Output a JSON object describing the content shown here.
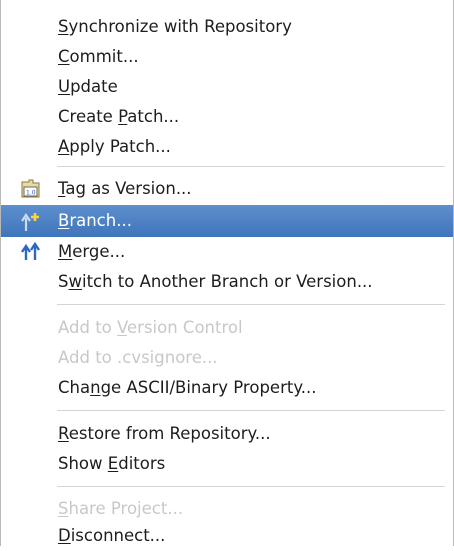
{
  "menu": {
    "items": [
      {
        "pre": "",
        "mn": "S",
        "post": "ynchronize with Repository",
        "enabled": true
      },
      {
        "pre": "",
        "mn": "C",
        "post": "ommit...",
        "enabled": true
      },
      {
        "pre": "",
        "mn": "U",
        "post": "pdate",
        "enabled": true
      },
      {
        "pre": "Create ",
        "mn": "P",
        "post": "atch...",
        "enabled": true
      },
      {
        "pre": "",
        "mn": "A",
        "post": "pply Patch...",
        "enabled": true
      },
      {
        "pre": "",
        "mn": "T",
        "post": "ag as Version...",
        "enabled": true,
        "icon": "tag-icon"
      },
      {
        "pre": "",
        "mn": "B",
        "post": "ranch...",
        "enabled": true,
        "icon": "branch-icon",
        "selected": true
      },
      {
        "pre": "",
        "mn": "M",
        "post": "erge...",
        "enabled": true,
        "icon": "merge-icon"
      },
      {
        "pre": "S",
        "mn": "w",
        "post": "itch to Another Branch or Version...",
        "enabled": true
      },
      {
        "pre": "Add to ",
        "mn": "V",
        "post": "ersion Control",
        "enabled": false
      },
      {
        "pre": "Add to .cvsignore...",
        "mn": "",
        "post": "",
        "enabled": false
      },
      {
        "pre": "Cha",
        "mn": "n",
        "post": "ge ASCII/Binary Property...",
        "enabled": true
      },
      {
        "pre": "",
        "mn": "R",
        "post": "estore from Repository...",
        "enabled": true
      },
      {
        "pre": "Show ",
        "mn": "E",
        "post": "ditors",
        "enabled": true
      },
      {
        "pre": "",
        "mn": "S",
        "post": "hare Project...",
        "enabled": false
      },
      {
        "pre": "",
        "mn": "D",
        "post": "isconnect...",
        "enabled": true
      }
    ]
  },
  "colors": {
    "selection": "#3f75bb",
    "disabled_text": "#c8c8c8",
    "text": "#1d1d1d"
  }
}
